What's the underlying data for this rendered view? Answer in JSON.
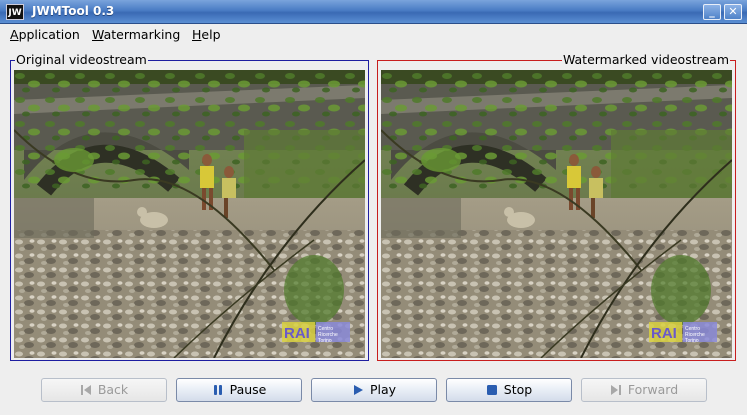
{
  "window": {
    "icon_label": "JW",
    "title": "JWMTool 0.3",
    "minimize_glyph": "_",
    "close_glyph": "✕"
  },
  "menu": {
    "items": [
      {
        "label": "Application"
      },
      {
        "label": "Watermarking"
      },
      {
        "label": "Help"
      }
    ]
  },
  "panels": {
    "left": {
      "title": "Original videostream",
      "border_color": "#1e1ea0"
    },
    "right": {
      "title": "Watermarked videostream",
      "border_color": "#c81e1e"
    }
  },
  "video_overlay": {
    "logo_text": "RAI",
    "logo_caption": "Centro Ricerche Torino"
  },
  "controls": {
    "back": {
      "label": "Back",
      "icon": "skip-back-icon",
      "enabled": false
    },
    "pause": {
      "label": "Pause",
      "icon": "pause-icon",
      "enabled": true
    },
    "play": {
      "label": "Play",
      "icon": "play-icon",
      "enabled": true
    },
    "stop": {
      "label": "Stop",
      "icon": "stop-icon",
      "enabled": true
    },
    "forward": {
      "label": "Forward",
      "icon": "skip-forward-icon",
      "enabled": false
    }
  },
  "colors": {
    "titlebar": "#4a7cc4",
    "icon_blue": "#2a5db0"
  }
}
